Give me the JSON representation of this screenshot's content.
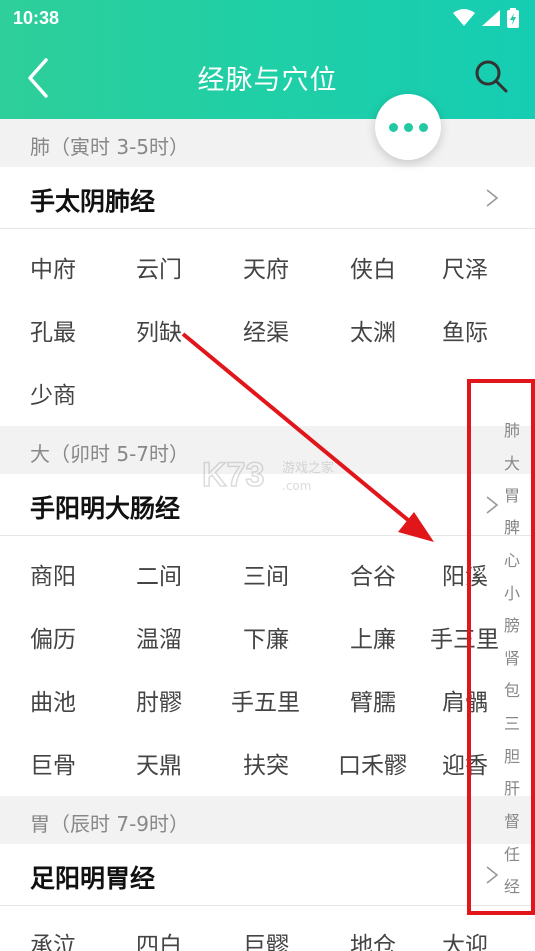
{
  "status_bar": {
    "time": "10:38"
  },
  "toolbar": {
    "title": "经脉与穴位"
  },
  "icons": {
    "back": "back-arrow-icon",
    "search": "search-icon",
    "more": "more-dots-icon",
    "chevron": "chevron-right-icon",
    "accent": "#22c9a3",
    "highlight": "#e0161b"
  },
  "sections": [
    {
      "header": "肺（寅时 3-5时）",
      "meridian": "手太阴肺经",
      "points": [
        "中府",
        "云门",
        "天府",
        "侠白",
        "尺泽",
        "孔最",
        "列缺",
        "经渠",
        "太渊",
        "鱼际",
        "少商"
      ]
    },
    {
      "header": "大（卯时 5-7时）",
      "meridian": "手阳明大肠经",
      "points": [
        "商阳",
        "二间",
        "三间",
        "合谷",
        "阳溪",
        "偏历",
        "温溜",
        "下廉",
        "上廉",
        "手三里",
        "曲池",
        "肘髎",
        "手五里",
        "臂臑",
        "肩髃",
        "巨骨",
        "天鼎",
        "扶突",
        "口禾髎",
        "迎香"
      ]
    },
    {
      "header": "胃（辰时 7-9时）",
      "meridian": "足阳明胃经",
      "points": [
        "承泣",
        "四白",
        "巨髎",
        "地仓",
        "大迎"
      ]
    }
  ],
  "index": [
    "肺",
    "大",
    "胃",
    "脾",
    "心",
    "小",
    "膀",
    "肾",
    "包",
    "三",
    "胆",
    "肝",
    "督",
    "任",
    "经"
  ],
  "watermark": {
    "brand": "K73",
    "text": "游戏之家",
    "domain": ".com"
  }
}
